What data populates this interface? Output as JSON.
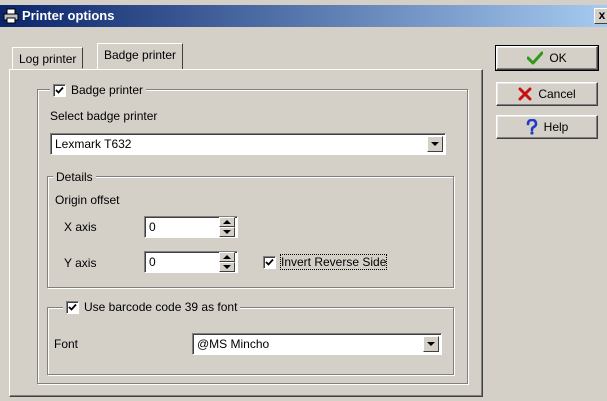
{
  "window": {
    "title": "Printer options",
    "close_glyph": "x"
  },
  "tabs": [
    {
      "label": "Log printer",
      "active": false
    },
    {
      "label": "Badge printer",
      "active": true
    }
  ],
  "badge_printer_group": {
    "checkbox_label": "Badge printer",
    "checked": true,
    "select_label": "Select badge printer",
    "selected_printer": "Lexmark T632"
  },
  "details": {
    "group_label": "Details",
    "origin_offset_label": "Origin offset",
    "x_axis_label": "X axis",
    "x_axis_value": "0",
    "y_axis_label": "Y axis",
    "y_axis_value": "0",
    "invert_label": "Invert Reverse Side",
    "invert_checked": true
  },
  "barcode_group": {
    "checkbox_label": "Use barcode code 39 as font",
    "checked": true,
    "font_label": "Font",
    "font_value": "@MS Mincho"
  },
  "buttons": {
    "ok_label": "OK",
    "cancel_label": "Cancel",
    "help_label": "Help"
  },
  "colors": {
    "titlebar_start": "#0a246a",
    "titlebar_end": "#a6caf0",
    "face": "#d4d0c8",
    "ok_icon": "#2e9a1a",
    "cancel_icon": "#c81010",
    "help_icon": "#1e3cc8"
  },
  "icons": {
    "title": "printer-icon",
    "ok": "checkmark-icon",
    "cancel": "cross-icon",
    "help": "question-mark-icon"
  }
}
